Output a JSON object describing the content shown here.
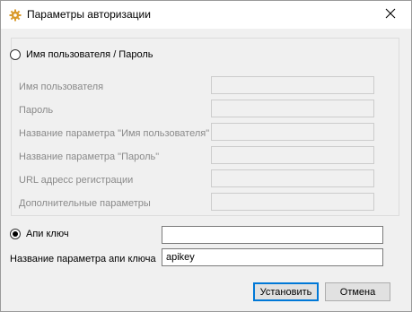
{
  "window": {
    "title": "Параметры авторизации",
    "close_glyph": "✕"
  },
  "auth_password": {
    "radio_label": "Имя пользователя / Пароль",
    "selected": false,
    "fields": [
      {
        "label": "Имя пользователя",
        "value": ""
      },
      {
        "label": "Пароль",
        "value": ""
      },
      {
        "label": "Название параметра \"Имя пользователя\"",
        "value": ""
      },
      {
        "label": "Название параметра \"Пароль\"",
        "value": ""
      },
      {
        "label": "URL адресс регистрации",
        "value": ""
      },
      {
        "label": "Дополнительные параметры",
        "value": ""
      }
    ]
  },
  "auth_apikey": {
    "radio_label": "Апи ключ",
    "selected": true,
    "key_value": "",
    "param_label": "Название параметра апи ключа",
    "param_value": "apikey"
  },
  "buttons": {
    "ok": "Установить",
    "cancel": "Отмена"
  },
  "icons": {
    "app": "gear-icon",
    "close": "close-icon"
  }
}
